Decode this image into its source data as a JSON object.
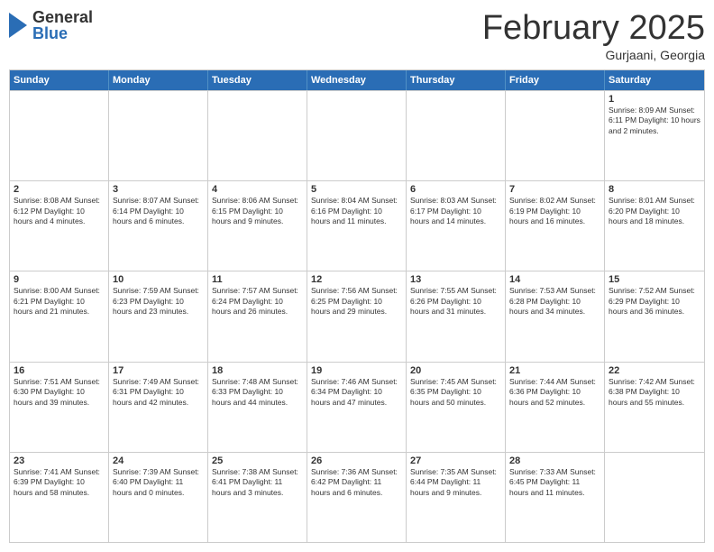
{
  "header": {
    "logo_general": "General",
    "logo_blue": "Blue",
    "month_title": "February 2025",
    "subtitle": "Gurjaani, Georgia"
  },
  "calendar": {
    "days_of_week": [
      "Sunday",
      "Monday",
      "Tuesday",
      "Wednesday",
      "Thursday",
      "Friday",
      "Saturday"
    ],
    "weeks": [
      [
        {
          "day": "",
          "text": ""
        },
        {
          "day": "",
          "text": ""
        },
        {
          "day": "",
          "text": ""
        },
        {
          "day": "",
          "text": ""
        },
        {
          "day": "",
          "text": ""
        },
        {
          "day": "",
          "text": ""
        },
        {
          "day": "1",
          "text": "Sunrise: 8:09 AM\nSunset: 6:11 PM\nDaylight: 10 hours and 2 minutes."
        }
      ],
      [
        {
          "day": "2",
          "text": "Sunrise: 8:08 AM\nSunset: 6:12 PM\nDaylight: 10 hours and 4 minutes."
        },
        {
          "day": "3",
          "text": "Sunrise: 8:07 AM\nSunset: 6:14 PM\nDaylight: 10 hours and 6 minutes."
        },
        {
          "day": "4",
          "text": "Sunrise: 8:06 AM\nSunset: 6:15 PM\nDaylight: 10 hours and 9 minutes."
        },
        {
          "day": "5",
          "text": "Sunrise: 8:04 AM\nSunset: 6:16 PM\nDaylight: 10 hours and 11 minutes."
        },
        {
          "day": "6",
          "text": "Sunrise: 8:03 AM\nSunset: 6:17 PM\nDaylight: 10 hours and 14 minutes."
        },
        {
          "day": "7",
          "text": "Sunrise: 8:02 AM\nSunset: 6:19 PM\nDaylight: 10 hours and 16 minutes."
        },
        {
          "day": "8",
          "text": "Sunrise: 8:01 AM\nSunset: 6:20 PM\nDaylight: 10 hours and 18 minutes."
        }
      ],
      [
        {
          "day": "9",
          "text": "Sunrise: 8:00 AM\nSunset: 6:21 PM\nDaylight: 10 hours and 21 minutes."
        },
        {
          "day": "10",
          "text": "Sunrise: 7:59 AM\nSunset: 6:23 PM\nDaylight: 10 hours and 23 minutes."
        },
        {
          "day": "11",
          "text": "Sunrise: 7:57 AM\nSunset: 6:24 PM\nDaylight: 10 hours and 26 minutes."
        },
        {
          "day": "12",
          "text": "Sunrise: 7:56 AM\nSunset: 6:25 PM\nDaylight: 10 hours and 29 minutes."
        },
        {
          "day": "13",
          "text": "Sunrise: 7:55 AM\nSunset: 6:26 PM\nDaylight: 10 hours and 31 minutes."
        },
        {
          "day": "14",
          "text": "Sunrise: 7:53 AM\nSunset: 6:28 PM\nDaylight: 10 hours and 34 minutes."
        },
        {
          "day": "15",
          "text": "Sunrise: 7:52 AM\nSunset: 6:29 PM\nDaylight: 10 hours and 36 minutes."
        }
      ],
      [
        {
          "day": "16",
          "text": "Sunrise: 7:51 AM\nSunset: 6:30 PM\nDaylight: 10 hours and 39 minutes."
        },
        {
          "day": "17",
          "text": "Sunrise: 7:49 AM\nSunset: 6:31 PM\nDaylight: 10 hours and 42 minutes."
        },
        {
          "day": "18",
          "text": "Sunrise: 7:48 AM\nSunset: 6:33 PM\nDaylight: 10 hours and 44 minutes."
        },
        {
          "day": "19",
          "text": "Sunrise: 7:46 AM\nSunset: 6:34 PM\nDaylight: 10 hours and 47 minutes."
        },
        {
          "day": "20",
          "text": "Sunrise: 7:45 AM\nSunset: 6:35 PM\nDaylight: 10 hours and 50 minutes."
        },
        {
          "day": "21",
          "text": "Sunrise: 7:44 AM\nSunset: 6:36 PM\nDaylight: 10 hours and 52 minutes."
        },
        {
          "day": "22",
          "text": "Sunrise: 7:42 AM\nSunset: 6:38 PM\nDaylight: 10 hours and 55 minutes."
        }
      ],
      [
        {
          "day": "23",
          "text": "Sunrise: 7:41 AM\nSunset: 6:39 PM\nDaylight: 10 hours and 58 minutes."
        },
        {
          "day": "24",
          "text": "Sunrise: 7:39 AM\nSunset: 6:40 PM\nDaylight: 11 hours and 0 minutes."
        },
        {
          "day": "25",
          "text": "Sunrise: 7:38 AM\nSunset: 6:41 PM\nDaylight: 11 hours and 3 minutes."
        },
        {
          "day": "26",
          "text": "Sunrise: 7:36 AM\nSunset: 6:42 PM\nDaylight: 11 hours and 6 minutes."
        },
        {
          "day": "27",
          "text": "Sunrise: 7:35 AM\nSunset: 6:44 PM\nDaylight: 11 hours and 9 minutes."
        },
        {
          "day": "28",
          "text": "Sunrise: 7:33 AM\nSunset: 6:45 PM\nDaylight: 11 hours and 11 minutes."
        },
        {
          "day": "",
          "text": ""
        }
      ]
    ]
  }
}
